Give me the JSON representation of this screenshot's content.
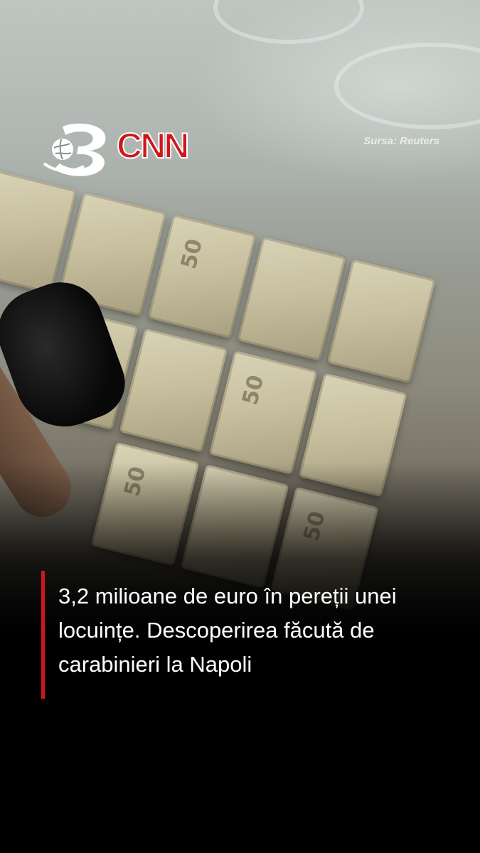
{
  "logo": {
    "channel_number": "3",
    "brand": "CNN",
    "brand_color": "#d0161b"
  },
  "source_label": "Sursa: Reuters",
  "headline": {
    "text": "3,2 milioane de euro în pereții unei locuințe. Descoperirea făcută de carabinieri la Napoli",
    "accent_color": "#d0161b"
  },
  "scene": {
    "banknote_values": [
      "50",
      "50",
      "50",
      "50"
    ]
  }
}
